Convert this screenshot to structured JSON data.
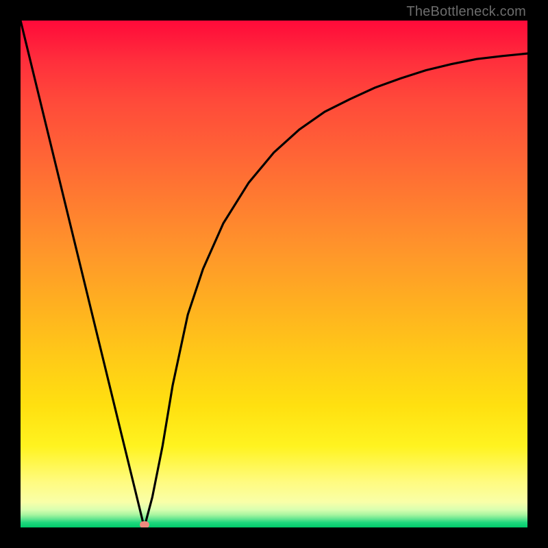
{
  "watermark": "TheBottleneck.com",
  "chart_data": {
    "type": "line",
    "title": "",
    "xlabel": "",
    "ylabel": "",
    "xlim": [
      0,
      1
    ],
    "ylim": [
      0,
      1
    ],
    "grid": false,
    "series": [
      {
        "name": "bottleneck-curve",
        "color": "#000000",
        "x": [
          0.0,
          0.05,
          0.1,
          0.15,
          0.2,
          0.225,
          0.244,
          0.26,
          0.28,
          0.3,
          0.33,
          0.36,
          0.4,
          0.45,
          0.5,
          0.55,
          0.6,
          0.65,
          0.7,
          0.75,
          0.8,
          0.85,
          0.9,
          0.95,
          1.0
        ],
        "y": [
          1.0,
          0.795,
          0.59,
          0.385,
          0.18,
          0.078,
          0.0,
          0.06,
          0.16,
          0.28,
          0.42,
          0.51,
          0.6,
          0.68,
          0.74,
          0.785,
          0.82,
          0.845,
          0.868,
          0.886,
          0.902,
          0.914,
          0.924,
          0.93,
          0.935
        ]
      }
    ],
    "markers": [
      {
        "name": "min-marker",
        "x": 0.244,
        "y": 0.006,
        "color": "#ef8a7e"
      }
    ],
    "background_gradient": {
      "direction": "vertical",
      "stops": [
        {
          "pos": 0.0,
          "color": "#ff0a3a"
        },
        {
          "pos": 0.26,
          "color": "#ff6336"
        },
        {
          "pos": 0.56,
          "color": "#ffb020"
        },
        {
          "pos": 0.84,
          "color": "#fff320"
        },
        {
          "pos": 0.97,
          "color": "#a8f5a0"
        },
        {
          "pos": 1.0,
          "color": "#00c96a"
        }
      ]
    }
  }
}
